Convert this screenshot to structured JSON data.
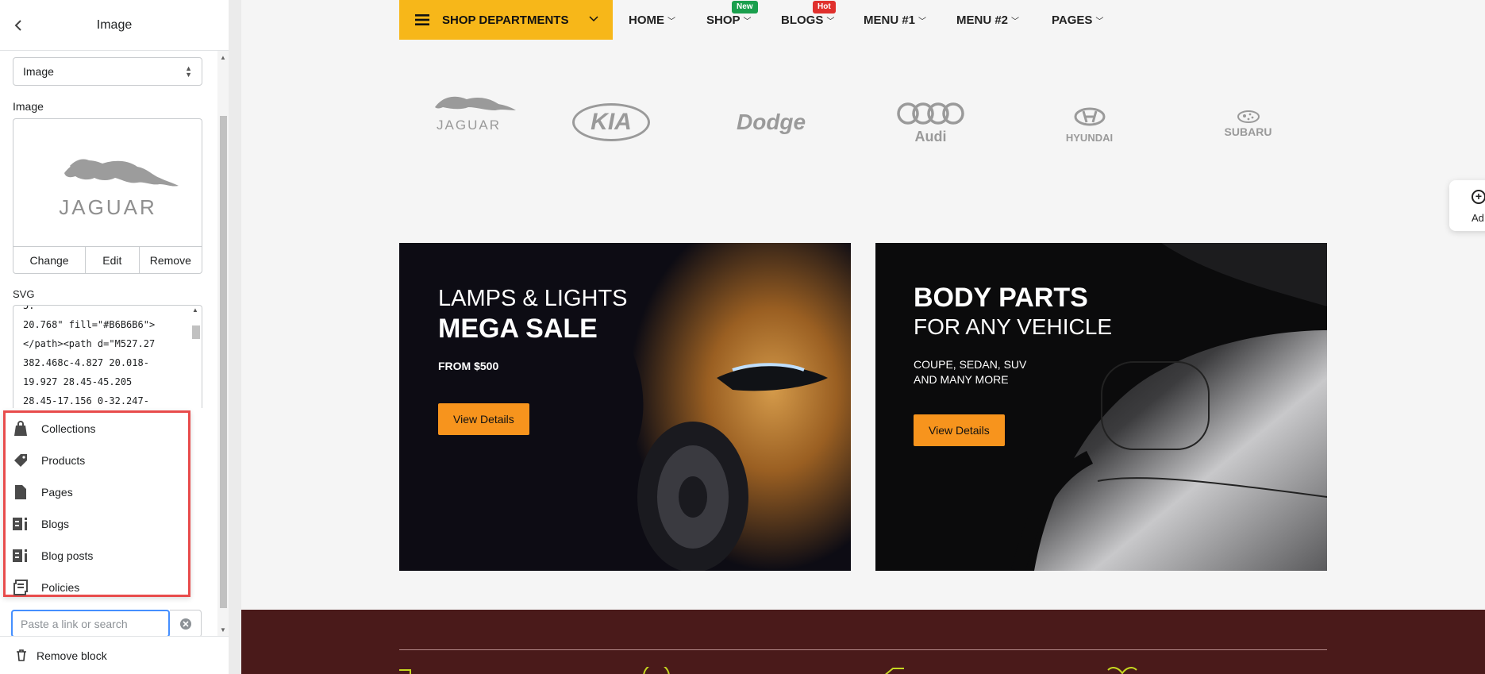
{
  "panel": {
    "title": "Image",
    "type_select_value": "Image",
    "image_label": "Image",
    "image_actions": {
      "change": "Change",
      "edit": "Edit",
      "remove": "Remove"
    },
    "svg_label": "SVG",
    "svg_lines": [
      "20.768\" fill=\"#B6B6B6\">",
      "</path><path d=\"M527.27",
      "382.468c-4.827 20.018-",
      "19.927 28.45-45.205",
      "28.45-17.156 0-32.247-"
    ],
    "dropdown_items": [
      {
        "label": "Collections",
        "icon": "collections-icon"
      },
      {
        "label": "Products",
        "icon": "tag-icon"
      },
      {
        "label": "Pages",
        "icon": "page-icon"
      },
      {
        "label": "Blogs",
        "icon": "blog-icon"
      },
      {
        "label": "Blog posts",
        "icon": "blog-post-icon"
      },
      {
        "label": "Policies",
        "icon": "policy-icon"
      }
    ],
    "link_search_placeholder": "Paste a link or search",
    "remove_block": "Remove block"
  },
  "preview": {
    "shop_departments": "SHOP DEPARTMENTS",
    "nav": [
      {
        "label": "HOME",
        "badge": ""
      },
      {
        "label": "SHOP",
        "badge": "New"
      },
      {
        "label": "BLOGS",
        "badge": "Hot"
      },
      {
        "label": "MENU #1",
        "badge": ""
      },
      {
        "label": "MENU #2",
        "badge": ""
      },
      {
        "label": "PAGES",
        "badge": ""
      }
    ],
    "brands": [
      "JAGUAR",
      "KIA",
      "Dodge",
      "Audi",
      "HYUNDAI",
      "SUBARU"
    ],
    "add_button_label": "Ad",
    "banner1": {
      "line1": "LAMPS & LIGHTS",
      "line2": "MEGA SALE",
      "sub": "FROM $500",
      "button": "View Details"
    },
    "banner2": {
      "line1": "BODY PARTS",
      "line2": "FOR ANY VEHICLE",
      "sub1": "COUPE, SEDAN, SUV",
      "sub2": "AND MANY MORE",
      "button": "View Details"
    }
  },
  "colors": {
    "accent_yellow": "#f7b719",
    "button_orange": "#f7941d",
    "badge_new": "#1a9f4d",
    "badge_hot": "#e0302d",
    "highlight_red": "#e84c4c",
    "focus_blue": "#458fff",
    "footer_band": "#4a1a1a"
  }
}
